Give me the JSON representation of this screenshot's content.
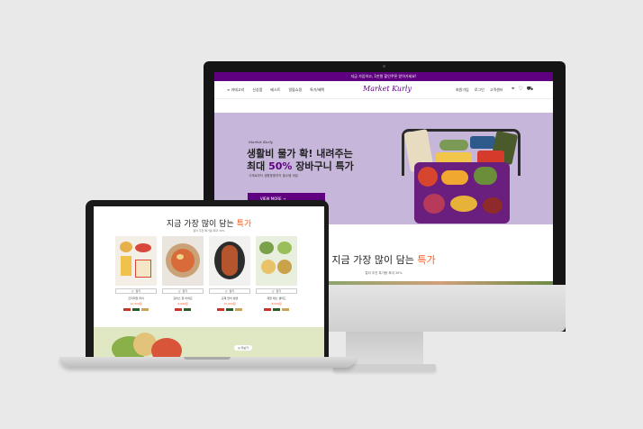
{
  "imac": {
    "topbar_text": "지금 가입하고, 1만원 할인쿠폰 받아가세요!",
    "nav": {
      "menu": [
        "≡ 카테고리",
        "신상품",
        "베스트",
        "알뜰쇼핑",
        "특가/혜택"
      ],
      "logo": "Market Kurly",
      "util": [
        "회원가입",
        "로그인",
        "고객센터"
      ],
      "icons": [
        "location-icon",
        "heart-icon",
        "cart-icon"
      ]
    },
    "hero": {
      "subtitle": "Market Kurly",
      "title_line1": "생활비 물가 확! 내려주는",
      "title_line2_prefix": "최대 ",
      "title_line2_highlight": "50%",
      "title_line2_suffix": " 장바구니 특가",
      "description": "식재료부터 생활용품까지 필수템 세일",
      "cta_label": "VIEW MORE →",
      "colors": {
        "background": "#c6b6d9",
        "accent": "#5f0080"
      }
    },
    "best": {
      "title_prefix": "지금 가장 많이 담는 ",
      "title_highlight": "특가",
      "subtitle": "컬리 추천 특가템 최대 30%"
    }
  },
  "laptop": {
    "title_prefix": "지금 가장 많이 담는 ",
    "title_highlight": "특가",
    "subtitle": "컬리 추천 특가템 최대 30%",
    "products": [
      {
        "cart_label": "담기",
        "name": "프리미엄 파이",
        "price": "12,900원"
      },
      {
        "cart_label": "담기",
        "name": "감바스 알 아히요",
        "price": "9,900원"
      },
      {
        "cart_label": "담기",
        "name": "훈제 연어 필렛",
        "price": "15,900원"
      },
      {
        "cart_label": "담기",
        "name": "제철 채소 샐러드",
        "price": "8,900원"
      }
    ],
    "banner_badge": "◎ 더보기",
    "colors": {
      "accent": "#ff5a20",
      "banner": "#dfe8c3"
    }
  }
}
